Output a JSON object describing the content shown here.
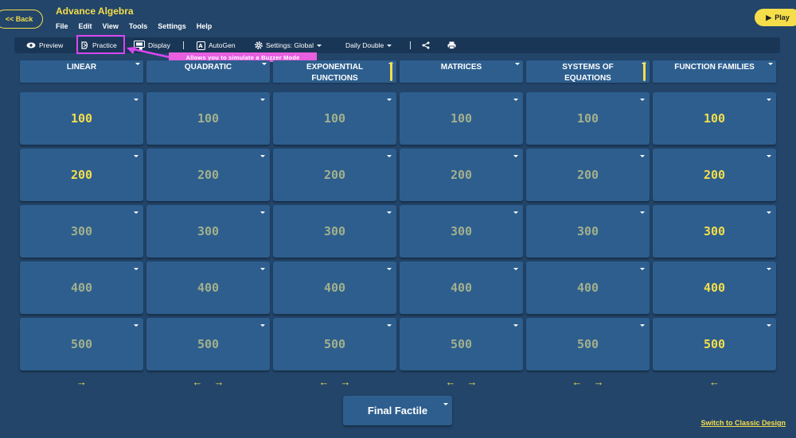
{
  "header": {
    "back_label": "<< Back",
    "title": "Advance Algebra",
    "menu": [
      "File",
      "Edit",
      "View",
      "Tools",
      "Settings",
      "Help"
    ],
    "play_label": "Play"
  },
  "toolbar": {
    "preview": "Preview",
    "practice": "Practice",
    "display": "Display",
    "autogen": "AutoGen",
    "settings": "Settings: Global",
    "daily_double": "Daily Double"
  },
  "callout": "Allows you to simulate a Buzzer Mode",
  "board": {
    "columns": [
      {
        "title": "LINEAR",
        "scroll": false,
        "values": [
          "100",
          "200",
          "300",
          "400",
          "500"
        ],
        "bright": [
          true,
          true,
          false,
          false,
          false
        ],
        "nav": [
          "→"
        ]
      },
      {
        "title": "QUADRATIC",
        "scroll": false,
        "values": [
          "100",
          "200",
          "300",
          "400",
          "500"
        ],
        "bright": [
          false,
          false,
          false,
          false,
          false
        ],
        "nav": [
          "←",
          "→"
        ]
      },
      {
        "title": "EXPONENTIAL FUNCTIONS",
        "scroll": true,
        "values": [
          "100",
          "200",
          "300",
          "400",
          "500"
        ],
        "bright": [
          false,
          false,
          false,
          false,
          false
        ],
        "nav": [
          "←",
          "→"
        ]
      },
      {
        "title": "MATRICES",
        "scroll": false,
        "values": [
          "100",
          "200",
          "300",
          "400",
          "500"
        ],
        "bright": [
          false,
          false,
          false,
          false,
          false
        ],
        "nav": [
          "←",
          "→"
        ]
      },
      {
        "title": "SYSTEMS OF EQUATIONS",
        "scroll": true,
        "values": [
          "100",
          "200",
          "300",
          "400",
          "500"
        ],
        "bright": [
          false,
          false,
          false,
          false,
          false
        ],
        "nav": [
          "←",
          "→"
        ]
      },
      {
        "title": "FUNCTION FAMILIES",
        "scroll": false,
        "values": [
          "100",
          "200",
          "300",
          "400",
          "500"
        ],
        "bright": [
          true,
          true,
          true,
          true,
          true
        ],
        "nav": [
          "←"
        ]
      }
    ]
  },
  "final_label": "Final Factile",
  "switch_label": "Switch to Classic Design",
  "colors": {
    "accent": "#f5de4a",
    "highlight": "#d946ef",
    "tile": "#2d5e8e",
    "background": "#23456a"
  }
}
